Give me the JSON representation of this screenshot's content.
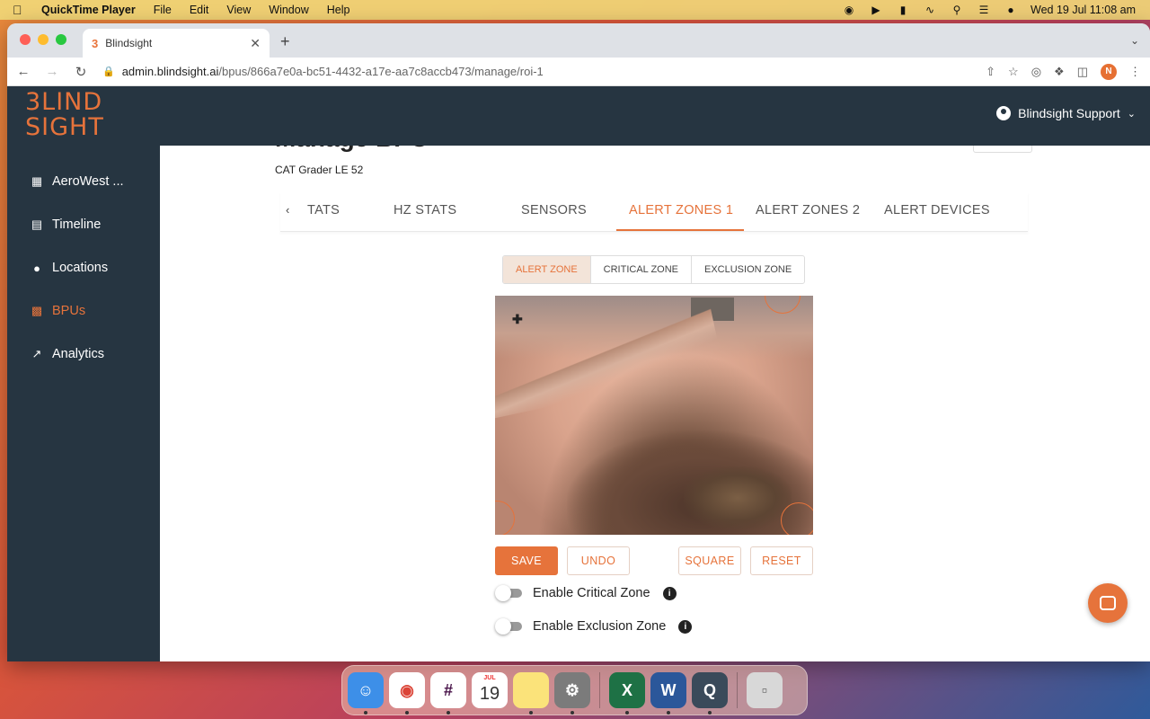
{
  "menubar": {
    "app_name": "QuickTime Player",
    "menus": [
      "File",
      "Edit",
      "View",
      "Window",
      "Help"
    ],
    "datetime": "Wed 19 Jul  11:08 am"
  },
  "browser": {
    "tab_title": "Blindsight",
    "tab_favicon": "3",
    "url_host": "admin.blindsight.ai",
    "url_path": "/bpus/866a7e0a-bc51-4432-a17e-aa7c8accb473/manage/roi-1",
    "profile_initial": "N"
  },
  "header": {
    "logo_line1": "3LIND",
    "logo_line2": "SIGHT",
    "user_name": "Blindsight Support"
  },
  "sidebar": {
    "items": [
      {
        "label": "AeroWest ...",
        "icon": "building-icon"
      },
      {
        "label": "Timeline",
        "icon": "timeline-icon"
      },
      {
        "label": "Locations",
        "icon": "pin-icon"
      },
      {
        "label": "BPUs",
        "icon": "chip-icon"
      },
      {
        "label": "Analytics",
        "icon": "chart-icon"
      }
    ],
    "active": "BPUs"
  },
  "page": {
    "title": "Manage BPU",
    "subtitle": "CAT Grader LE 52"
  },
  "tabs": {
    "items": [
      "TATS",
      "HZ STATS",
      "SENSORS",
      "ALERT ZONES 1",
      "ALERT ZONES 2",
      "ALERT DEVICES"
    ],
    "active": "ALERT ZONES 1"
  },
  "zone_toggle": {
    "items": [
      "ALERT ZONE",
      "CRITICAL ZONE",
      "EXCLUSION ZONE"
    ],
    "active": "ALERT ZONE"
  },
  "actions": {
    "save": "SAVE",
    "undo": "UNDO",
    "square": "SQUARE",
    "reset": "RESET"
  },
  "toggles": {
    "critical": "Enable Critical Zone",
    "exclusion": "Enable Exclusion Zone"
  },
  "colors": {
    "accent": "#e6733b",
    "sidebar_bg": "#263541"
  }
}
